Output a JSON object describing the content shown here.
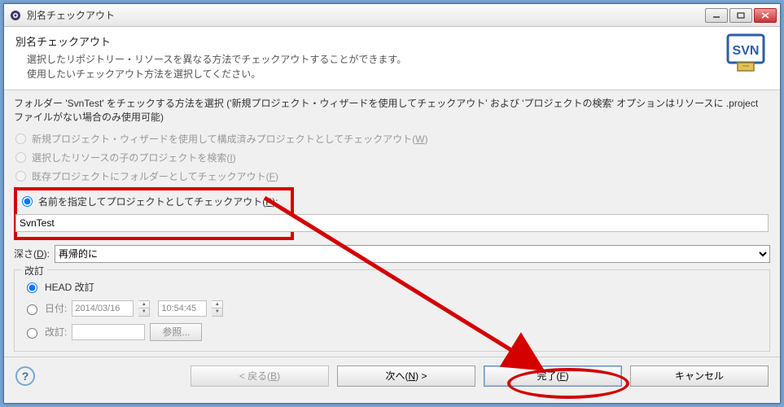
{
  "titlebar": {
    "title": "別名チェックアウト"
  },
  "header": {
    "title": "別名チェックアウト",
    "desc": "選択したリポジトリー・リソースを異なる方法でチェックアウトすることができます。\n使用したいチェックアウト方法を選択してください。"
  },
  "body": {
    "instr": "フォルダー 'SvnTest' をチェックする方法を選択 ('新規プロジェクト・ウィザードを使用してチェックアウト' および 'プロジェクトの検索' オプションはリソースに .project ファイルがない場合のみ使用可能)",
    "radio1": "新規プロジェクト・ウィザードを使用して構成済みプロジェクトとしてチェックアウト(",
    "radio1_key": "W",
    "radio1_suffix": ")",
    "radio2": "選択したリソースの子のプロジェクトを検索(",
    "radio2_key": "I",
    "radio2_suffix": ")",
    "radio3": "既存プロジェクトにフォルダーとしてチェックアウト(",
    "radio3_key": "F",
    "radio3_suffix": ")",
    "radio4": "名前を指定してプロジェクトとしてチェックアウト(",
    "radio4_key": "P",
    "radio4_suffix": "):",
    "project_name": "SvnTest",
    "depth_label": "深さ(",
    "depth_key": "D",
    "depth_suffix": "):",
    "depth_value": "再帰的に",
    "revision_legend": "改訂",
    "rev_head": "HEAD 改訂",
    "rev_date": "日付:",
    "rev_date_val": "2014/03/16",
    "rev_time_val": "10:54:45",
    "rev_num": "改訂:",
    "browse": "参照..."
  },
  "footer": {
    "back": "< 戻る(",
    "back_key": "B",
    "back_suffix": ")",
    "next": "次へ(",
    "next_key": "N",
    "next_suffix": ") >",
    "finish": "完了(",
    "finish_key": "F",
    "finish_suffix": ")",
    "cancel": "キャンセル"
  }
}
